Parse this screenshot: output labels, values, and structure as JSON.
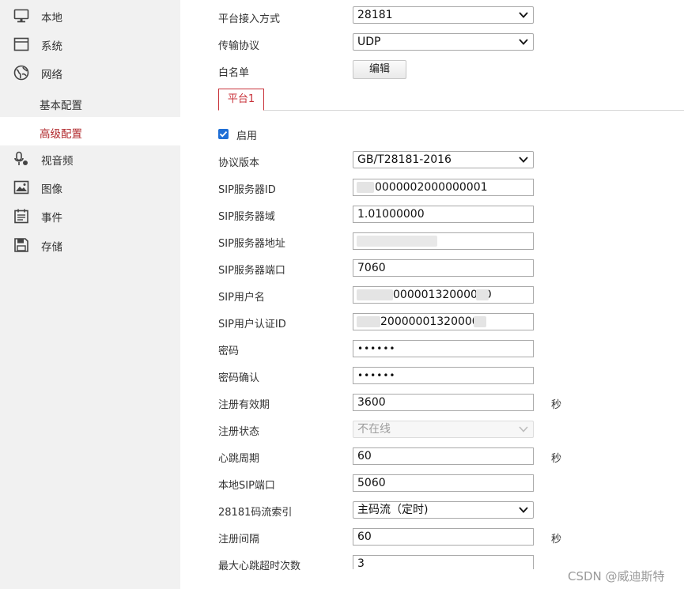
{
  "sidebar": {
    "items": [
      {
        "label": "本地",
        "icon": "monitor-icon"
      },
      {
        "label": "系统",
        "icon": "window-icon"
      },
      {
        "label": "网络",
        "icon": "globe-icon"
      },
      {
        "label": "视音频",
        "icon": "microphone-icon"
      },
      {
        "label": "图像",
        "icon": "image-icon"
      },
      {
        "label": "事件",
        "icon": "calendar-icon"
      },
      {
        "label": "存储",
        "icon": "floppy-disk-icon"
      }
    ],
    "sub_items": [
      {
        "label": "基本配置",
        "active": false
      },
      {
        "label": "高级配置",
        "active": true
      }
    ]
  },
  "top_form": {
    "access_mode": {
      "label": "平台接入方式",
      "value": "28181"
    },
    "transport": {
      "label": "传输协议",
      "value": "UDP"
    },
    "whitelist": {
      "label": "白名单",
      "button": "编辑"
    }
  },
  "tab": {
    "label": "平台1"
  },
  "enable": {
    "label": "启用",
    "checked": true
  },
  "fields": {
    "protocol_version": {
      "label": "协议版本",
      "value": "GB/T28181-2016"
    },
    "sip_server_id": {
      "label": "SIP服务器ID",
      "value": "0000002000000001"
    },
    "sip_server_domain": {
      "label": "SIP服务器域",
      "value": "1.01000000"
    },
    "sip_server_address": {
      "label": "SIP服务器地址",
      "value": ""
    },
    "sip_server_port": {
      "label": "SIP服务器端口",
      "value": "7060"
    },
    "sip_username": {
      "label": "SIP用户名",
      "value": "00000132000000"
    },
    "sip_auth_id": {
      "label": "SIP用户认证ID",
      "value": "200000013200000"
    },
    "password": {
      "label": "密码",
      "value": "••••••"
    },
    "password_confirm": {
      "label": "密码确认",
      "value": "••••••"
    },
    "reg_validity": {
      "label": "注册有效期",
      "value": "3600",
      "unit": "秒"
    },
    "reg_status": {
      "label": "注册状态",
      "value": "不在线"
    },
    "heartbeat": {
      "label": "心跳周期",
      "value": "60",
      "unit": "秒"
    },
    "local_sip_port": {
      "label": "本地SIP端口",
      "value": "5060"
    },
    "stream_index": {
      "label": "28181码流索引",
      "value": "主码流（定时)"
    },
    "reg_interval": {
      "label": "注册间隔",
      "value": "60",
      "unit": "秒"
    },
    "max_heartbeat_timeout": {
      "label": "最大心跳超时次数",
      "value": "3"
    }
  },
  "watermark": "CSDN @威迪斯特",
  "colors": {
    "accent": "#b0272b",
    "sidebar_bg": "#f1f1f1",
    "checkbox": "#1f6fd6"
  }
}
